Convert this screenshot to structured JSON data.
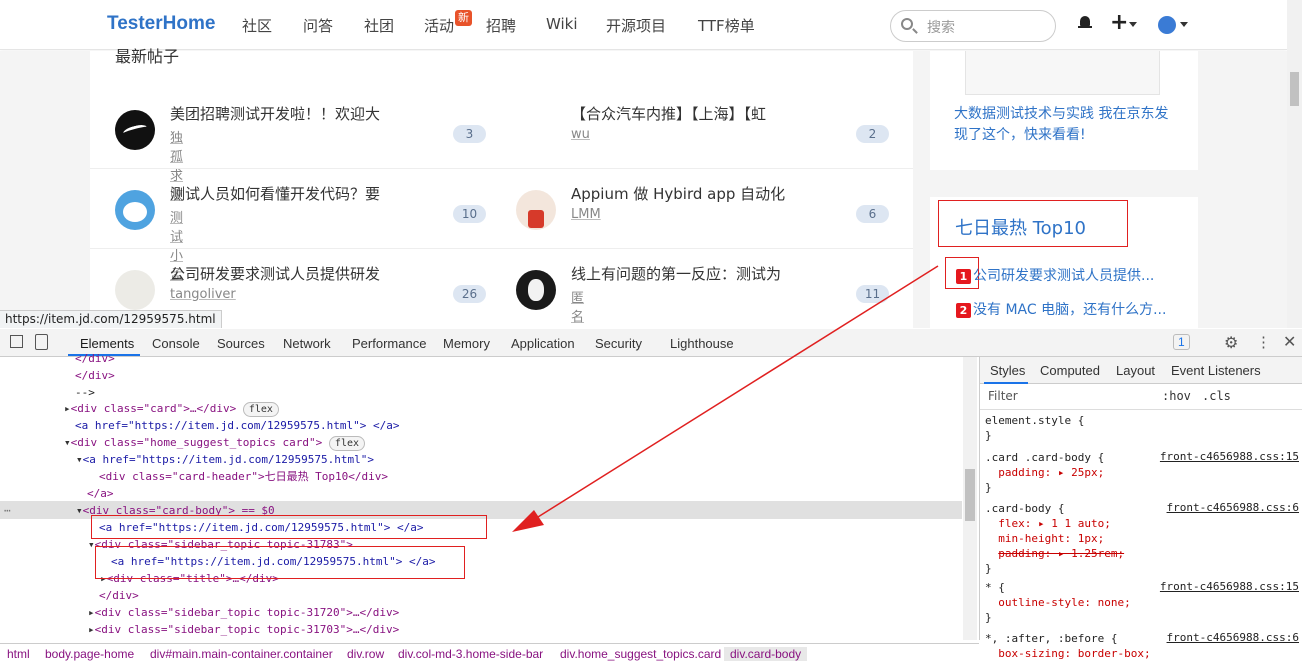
{
  "nav": {
    "brand": "TesterHome",
    "links": [
      "社区",
      "问答",
      "社团",
      "活动",
      "招聘",
      "Wiki",
      "开源项目",
      "TTF榜单"
    ],
    "new_badge": "新",
    "search_placeholder": "搜索"
  },
  "main": {
    "section_title": "最新帖子",
    "topics": [
      {
        "title": "美团招聘测试开发啦！！欢迎大",
        "author": "独孤求败",
        "count": "3"
      },
      {
        "title": "【合众汽车内推】【上海】【虹",
        "author": "wu",
        "count": "2"
      },
      {
        "title": "测试人员如何看懂开发代码？要",
        "author": "测试小孟",
        "count": "10"
      },
      {
        "title": "Appium 做 Hybird app 自动化",
        "author": "LMM",
        "count": "6"
      },
      {
        "title": "公司研发要求测试人员提供研发",
        "author": "tangoliver",
        "count": "26"
      },
      {
        "title": "线上有问题的第一反应：测试为",
        "author": "匿名",
        "count": "11"
      }
    ]
  },
  "side": {
    "ad_text": "大数据测试技术与实践 我在京东发现了这个，快来看看!",
    "hot_title": "七日最热 Top10",
    "hot_items": [
      {
        "num": "1",
        "text": "公司研发要求测试人员提供..."
      },
      {
        "num": "2",
        "text": "没有 MAC 电脑，还有什么方..."
      }
    ]
  },
  "status_url": "https://item.jd.com/12959575.html",
  "devtools": {
    "tabs": [
      "Elements",
      "Console",
      "Sources",
      "Network",
      "Performance",
      "Memory",
      "Application",
      "Security",
      "Lighthouse"
    ],
    "issues_count": "1",
    "dom_lines": [
      "</div>",
      "</div>",
      "-->",
      "<div class=\"card\">…</div>",
      "<a href=\"https://item.jd.com/12959575.html\"> </a>",
      "<div class=\"home_suggest_topics card\">",
      "<a href=\"https://item.jd.com/12959575.html\">",
      "<div class=\"card-header\">七日最热 Top10</div>",
      "</a>",
      "<div class=\"card-body\"> == $0",
      "<a href=\"https://item.jd.com/12959575.html\"> </a>",
      "<div class=\"sidebar_topic topic-31783\">",
      "<a href=\"https://item.jd.com/12959575.html\"> </a>",
      "<div class=\"title\">…</div>",
      "</div>",
      "<div class=\"sidebar_topic topic-31720\">…</div>",
      "<div class=\"sidebar_topic topic-31703\">…</div>"
    ],
    "flex_badge": "flex",
    "styles_tabs": [
      "Styles",
      "Computed",
      "Layout",
      "Event Listeners"
    ],
    "filter_placeholder": "Filter",
    "hov": ":hov",
    ".cls": ".cls",
    "cls": ".cls",
    "rules": [
      {
        "selector": "element.style {",
        "decls": [],
        "source": ""
      },
      {
        "selector": ".card .card-body {",
        "decls": [
          "padding: ▸ 25px;"
        ],
        "source": "front-c4656988.css:15"
      },
      {
        "selector": ".card-body {",
        "decls": [
          "flex: ▸ 1 1 auto;",
          "min-height: 1px;",
          "padding: ▸ 1.25rem;"
        ],
        "source": "front-c4656988.css:6"
      },
      {
        "selector": "* {",
        "decls": [
          "outline-style: none;"
        ],
        "source": "front-c4656988.css:15"
      },
      {
        "selector": "*, :after, :before {",
        "decls": [
          "box-sizing: border-box;"
        ],
        "source": "front-c4656988.css:6"
      }
    ],
    "breadcrumbs": [
      "html",
      "body.page-home",
      "div#main.main-container.container",
      "div.row",
      "div.col-md-3.home-side-bar",
      "div.home_suggest_topics.card",
      "div.card-body"
    ]
  }
}
